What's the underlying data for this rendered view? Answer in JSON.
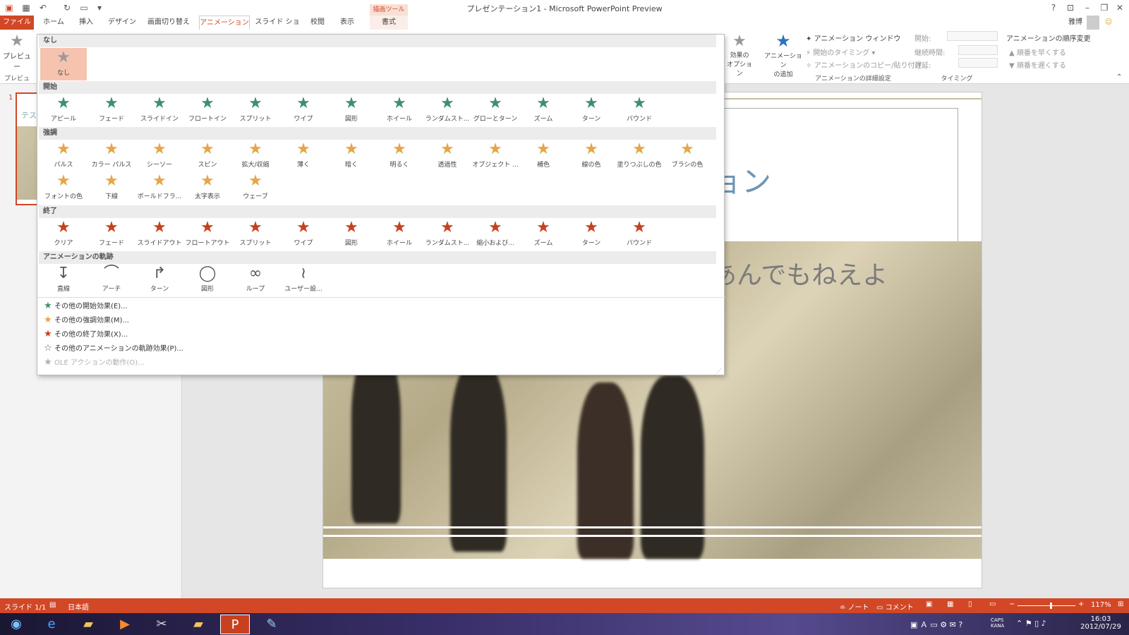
{
  "window": {
    "title": "プレゼンテーション1 - Microsoft PowerPoint Preview",
    "user": "雅博"
  },
  "tabs": {
    "file": "ファイル",
    "home": "ホーム",
    "insert": "挿入",
    "design": "デザイン",
    "transitions": "画面切り替え",
    "animations": "アニメーション",
    "slideshow": "スライド ショー",
    "review": "校閲",
    "view": "表示",
    "tools_context": "描画ツール",
    "format": "書式"
  },
  "ribbon": {
    "preview_label": "プレビュー",
    "preview_group": "プレビュー",
    "effect_options": [
      "効果の",
      "オプション"
    ],
    "add_animation": [
      "アニメーション",
      "の追加"
    ],
    "animation_pane": "アニメーション ウィンドウ",
    "trigger": "開始のタイミング",
    "painter": "アニメーションのコピー/貼り付け",
    "advanced_group": "アニメーションの詳細設定",
    "start_label": "開始:",
    "duration_label": "継続時間:",
    "delay_label": "遅延:",
    "timing_group": "タイミング",
    "reorder_title": "アニメーションの順序変更",
    "move_earlier": "順番を早くする",
    "move_later": "順番を遅くする"
  },
  "gallery": {
    "none_header": "なし",
    "none_items": [
      {
        "label": "なし",
        "icon": "star-gray-icon",
        "color": "#9a9a9a"
      }
    ],
    "entrance_header": "開始",
    "entrance": [
      {
        "label": "アピール"
      },
      {
        "label": "フェード"
      },
      {
        "label": "スライドイン"
      },
      {
        "label": "フロートイン"
      },
      {
        "label": "スプリット"
      },
      {
        "label": "ワイプ"
      },
      {
        "label": "図形"
      },
      {
        "label": "ホイール"
      },
      {
        "label": "ランダムスト..."
      },
      {
        "label": "グローとターン"
      },
      {
        "label": "ズーム"
      },
      {
        "label": "ターン"
      },
      {
        "label": "バウンド"
      }
    ],
    "emphasis_header": "強調",
    "emphasis": [
      {
        "label": "パルス"
      },
      {
        "label": "カラー パルス"
      },
      {
        "label": "シーソー"
      },
      {
        "label": "スピン"
      },
      {
        "label": "拡大/収縮"
      },
      {
        "label": "薄く"
      },
      {
        "label": "暗く"
      },
      {
        "label": "明るく"
      },
      {
        "label": "透過性"
      },
      {
        "label": "オブジェクト ..."
      },
      {
        "label": "補色"
      },
      {
        "label": "線の色"
      },
      {
        "label": "塗りつぶしの色"
      },
      {
        "label": "ブラシの色"
      },
      {
        "label": "フォントの色"
      },
      {
        "label": "下線"
      },
      {
        "label": "ボールドフラ..."
      },
      {
        "label": "太字表示"
      },
      {
        "label": "ウェーブ"
      }
    ],
    "exit_header": "終了",
    "exit": [
      {
        "label": "クリア"
      },
      {
        "label": "フェード"
      },
      {
        "label": "スライドアウト"
      },
      {
        "label": "フロートアウト"
      },
      {
        "label": "スプリット"
      },
      {
        "label": "ワイプ"
      },
      {
        "label": "図形"
      },
      {
        "label": "ホイール"
      },
      {
        "label": "ランダムスト..."
      },
      {
        "label": "縮小および..."
      },
      {
        "label": "ズーム"
      },
      {
        "label": "ターン"
      },
      {
        "label": "バウンド"
      }
    ],
    "paths_header": "アニメーションの軌跡",
    "paths": [
      {
        "label": "直線"
      },
      {
        "label": "アーチ"
      },
      {
        "label": "ターン"
      },
      {
        "label": "図形"
      },
      {
        "label": "ループ"
      },
      {
        "label": "ユーザー設..."
      }
    ],
    "more": [
      {
        "label": "その他の開始効果(E)...",
        "color": "#3f8f6e"
      },
      {
        "label": "その他の強調効果(M)...",
        "color": "#e3a64a"
      },
      {
        "label": "その他の終了効果(X)...",
        "color": "#c9401f"
      },
      {
        "label": "その他のアニメーションの軌跡効果(P)...",
        "color": "#666666"
      },
      {
        "label": "OLE アクションの動作(O)...",
        "color": "#b0b0b0"
      }
    ]
  },
  "slide": {
    "thumb_number": "1",
    "thumb_text": "テス",
    "title_fragment": "ョン",
    "subtitle_fragment": "あんでもねえよ"
  },
  "status": {
    "slide": "スライド 1/1",
    "language": "日本語",
    "notes": "ノート",
    "comments": "コメント",
    "zoom": "117%"
  },
  "taskbar": {
    "time": "16:03",
    "date": "2012/07/29"
  },
  "colors": {
    "accent": "#d24726",
    "entrance": "#3f8f6e",
    "emphasis": "#e3a64a",
    "exit": "#c9401f"
  }
}
